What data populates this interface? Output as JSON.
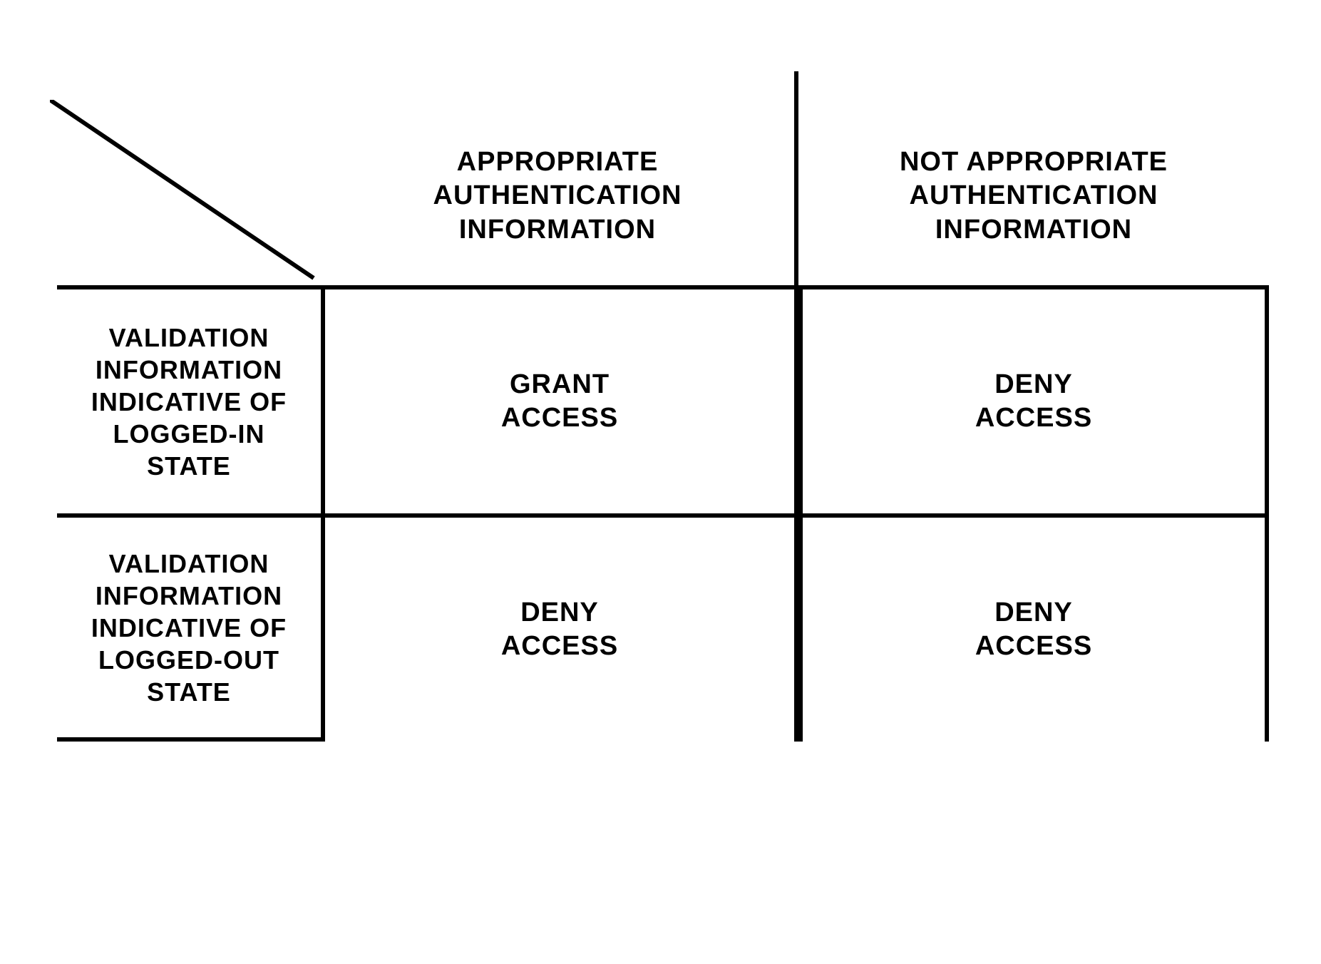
{
  "chart_data": {
    "type": "table",
    "title": "",
    "columns": [
      "APPROPRIATE\nAUTHENTICATION INFORMATION",
      "NOT APPROPRIATE\nAUTHENTICATION INFORMATION"
    ],
    "rows": [
      "VALIDATION\nINFORMATION\nINDICATIVE OF\nLOGGED-IN\nSTATE",
      "VALIDATION\nINFORMATION\nINDICATIVE OF\nLOGGED-OUT\nSTATE"
    ],
    "cells": [
      [
        "GRANT\nACCESS",
        "DENY\nACCESS"
      ],
      [
        "DENY\nACCESS",
        "DENY\nACCESS"
      ]
    ]
  }
}
